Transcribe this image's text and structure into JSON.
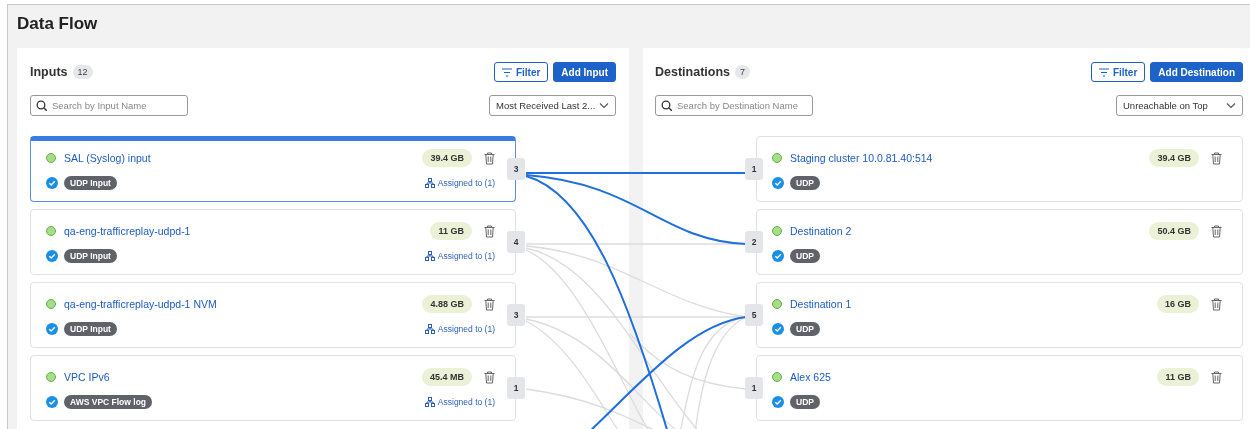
{
  "page": {
    "title": "Data Flow"
  },
  "inputs": {
    "title": "Inputs",
    "count": "12",
    "filter_button": "Filter",
    "add_button": "Add Input",
    "search": {
      "placeholder": "Search by Input Name"
    },
    "sort": {
      "value": "Most Received Last 2..."
    },
    "items": [
      {
        "name": "SAL (Syslog) input",
        "online": true,
        "volume": "39.4 GB",
        "selected": true,
        "verified": true,
        "tag": "UDP Input",
        "assigned": "Assigned to (1)",
        "link_count": "3"
      },
      {
        "name": "qa-eng-trafficreplay-udpd-1",
        "online": true,
        "volume": "11 GB",
        "selected": false,
        "verified": true,
        "tag": "UDP Input",
        "assigned": "Assigned to (1)",
        "link_count": "4"
      },
      {
        "name": "qa-eng-trafficreplay-udpd-1 NVM",
        "online": true,
        "volume": "4.88 GB",
        "selected": false,
        "verified": true,
        "tag": "UDP Input",
        "assigned": "Assigned to (1)",
        "link_count": "3"
      },
      {
        "name": "VPC IPv6",
        "online": true,
        "volume": "45.4 MB",
        "selected": false,
        "verified": true,
        "tag": "AWS VPC Flow log",
        "assigned": "Assigned to (1)",
        "link_count": "1"
      }
    ]
  },
  "destinations": {
    "title": "Destinations",
    "count": "7",
    "filter_button": "Filter",
    "add_button": "Add Destination",
    "search": {
      "placeholder": "Search by Destination Name"
    },
    "sort": {
      "value": "Unreachable on Top"
    },
    "items": [
      {
        "name": "Staging cluster 10.0.81.40:514",
        "online": true,
        "volume": "39.4 GB",
        "verified": true,
        "tag": "UDP",
        "link_count": "1"
      },
      {
        "name": "Destination 2",
        "online": true,
        "volume": "50.4 GB",
        "verified": true,
        "tag": "UDP",
        "link_count": "2"
      },
      {
        "name": "Destination 1",
        "online": true,
        "volume": "16 GB",
        "verified": true,
        "tag": "UDP",
        "link_count": "5"
      },
      {
        "name": "Alex 625",
        "online": true,
        "volume": "11 GB",
        "verified": true,
        "tag": "UDP",
        "link_count": "1"
      }
    ]
  }
}
